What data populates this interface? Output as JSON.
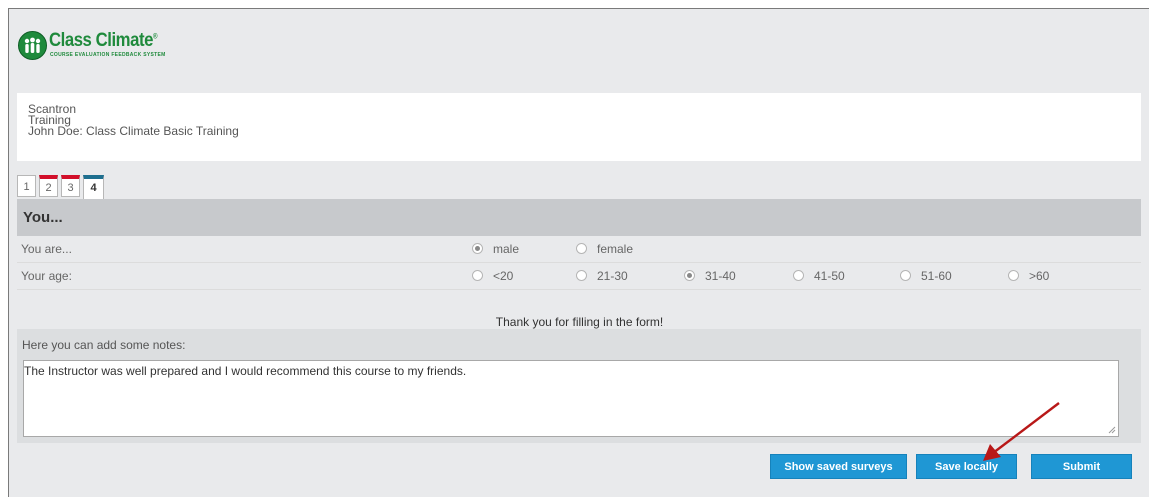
{
  "header": {
    "logo_title": "Class Climate",
    "logo_subtitle": "COURSE EVALUATION FEEDBACK SYSTEM",
    "logo_mark": "®"
  },
  "info": {
    "line1": "Scantron",
    "line2": "Training",
    "line3": "John Doe: Class Climate Basic Training"
  },
  "tabs": [
    {
      "label": "1",
      "status": "plain"
    },
    {
      "label": "2",
      "status": "red"
    },
    {
      "label": "3",
      "status": "red"
    },
    {
      "label": "4",
      "status": "blue-active"
    }
  ],
  "section": {
    "title": "You...",
    "questions": [
      {
        "label": "You are...",
        "options": [
          {
            "label": "male",
            "selected": true
          },
          {
            "label": "female",
            "selected": false
          }
        ]
      },
      {
        "label": "Your age:",
        "options": [
          {
            "label": "<20",
            "selected": false
          },
          {
            "label": "21-30",
            "selected": false
          },
          {
            "label": "31-40",
            "selected": true
          },
          {
            "label": "41-50",
            "selected": false
          },
          {
            "label": "51-60",
            "selected": false
          },
          {
            "label": ">60",
            "selected": false
          }
        ]
      }
    ]
  },
  "thanks": "Thank you for filling in the form!",
  "notes": {
    "label": "Here you can add some notes:",
    "value": "The Instructor was well prepared and I would recommend this course to my friends."
  },
  "buttons": {
    "show_saved": "Show saved surveys",
    "save_locally": "Save locally",
    "submit": "Submit"
  },
  "colors": {
    "accent": "#1f97d4",
    "brand": "#1f8a3c",
    "tab_red": "#d20f2a",
    "tab_blue": "#1e6f8f",
    "arrow": "#b81818"
  }
}
